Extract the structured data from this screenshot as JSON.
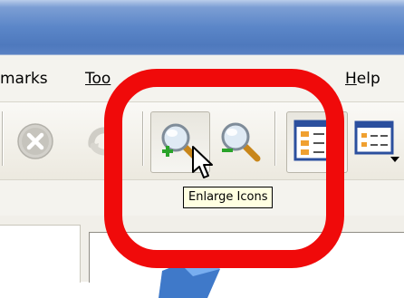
{
  "window": {
    "titlebar_color": "#5b86c8"
  },
  "menu": {
    "bookmarks_partial": "marks",
    "tools_partial": "Too",
    "help_first": "H",
    "help_rest": "elp"
  },
  "toolbar": {
    "buttons": [
      {
        "name": "stop",
        "icon": "stop-icon",
        "enabled": false
      },
      {
        "name": "reload",
        "icon": "reload-icon",
        "enabled": false
      },
      {
        "name": "enlarge-icons",
        "icon": "zoom-in-icon",
        "pressed": true
      },
      {
        "name": "shrink-icons",
        "icon": "zoom-out-icon"
      },
      {
        "name": "icon-view",
        "icon": "icon-view-icon",
        "pressed": true
      },
      {
        "name": "details-view",
        "icon": "details-view-icon"
      }
    ]
  },
  "tooltip": {
    "text": "Enlarge Icons"
  },
  "highlight": {
    "color": "#f00a0a"
  }
}
